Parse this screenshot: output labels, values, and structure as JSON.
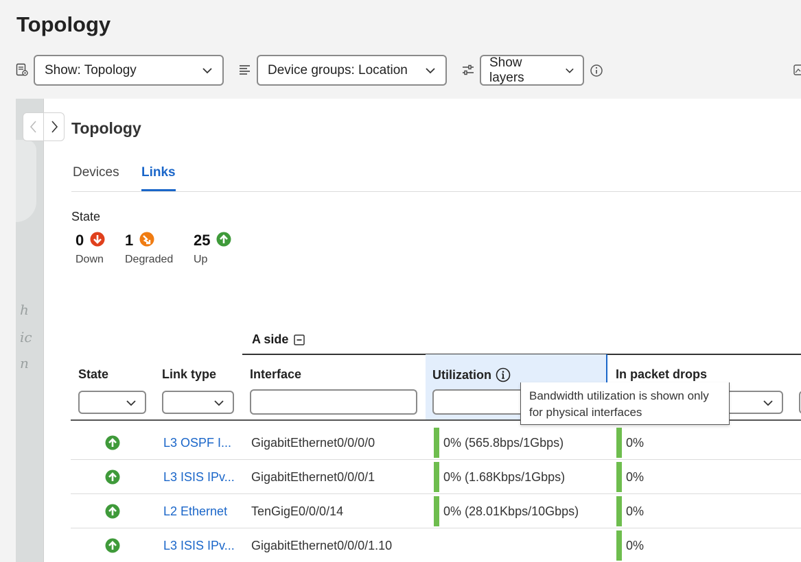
{
  "page_title": "Topology",
  "toolbar": {
    "show_dropdown": "Show: Topology",
    "groups_dropdown": "Device groups: Location",
    "layers_dropdown": "Show layers"
  },
  "map_labels": [
    "h",
    "ic",
    "n"
  ],
  "panel": {
    "title": "Topology",
    "tabs": [
      {
        "label": "Devices",
        "active": false
      },
      {
        "label": "Links",
        "active": true
      }
    ],
    "state_label": "State",
    "stats": [
      {
        "count": "0",
        "caption": "Down",
        "color": "#e0401c"
      },
      {
        "count": "1",
        "caption": "Degraded",
        "color": "#f07c12"
      },
      {
        "count": "25",
        "caption": "Up",
        "color": "#3f9a3a"
      }
    ]
  },
  "table": {
    "group_header": "A side",
    "columns": {
      "state": "State",
      "link_type": "Link type",
      "interface": "Interface",
      "utilization": "Utilization",
      "in_packet_drops": "In packet drops"
    },
    "tooltip": "Bandwidth utilization is shown only for physical interfaces",
    "rows": [
      {
        "state": "up",
        "link_type": "L3 OSPF I...",
        "interface": "GigabitEthernet0/0/0/0",
        "utilization": "0% (565.8bps/1Gbps)",
        "in_packet_drops": "0%"
      },
      {
        "state": "up",
        "link_type": "L3 ISIS IPv...",
        "interface": "GigabitEthernet0/0/0/1",
        "utilization": "0% (1.68Kbps/1Gbps)",
        "in_packet_drops": "0%"
      },
      {
        "state": "up",
        "link_type": "L2 Ethernet",
        "interface": "TenGigE0/0/0/14",
        "utilization": "0% (28.01Kbps/10Gbps)",
        "in_packet_drops": "0%"
      },
      {
        "state": "up",
        "link_type": "L3 ISIS IPv...",
        "interface": "GigabitEthernet0/0/0/1.10",
        "utilization": "",
        "in_packet_drops": "0%"
      }
    ]
  },
  "colors": {
    "accent": "#1a66c9",
    "up": "#3f9a3a",
    "bar": "#6ebd4e"
  }
}
